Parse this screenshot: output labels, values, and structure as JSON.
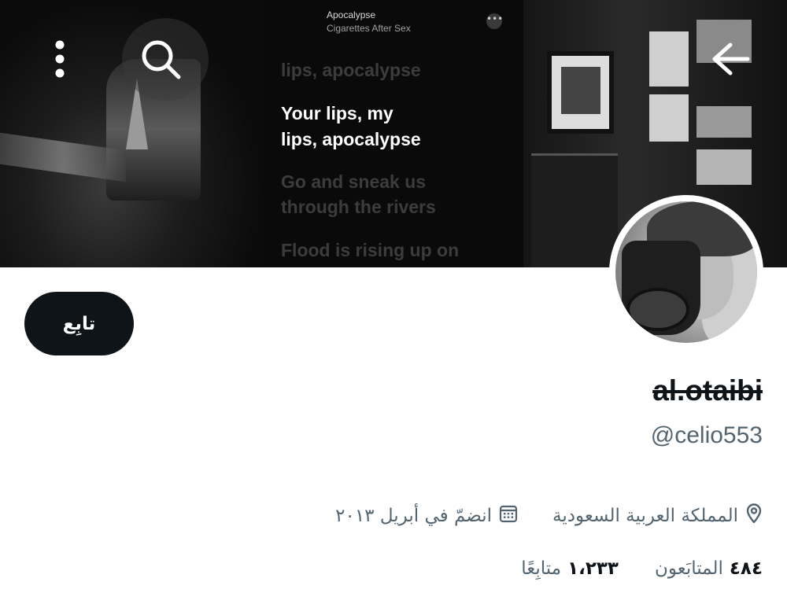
{
  "banner": {
    "song_title": "Apocalypse",
    "song_artist": "Cigarettes After Sex",
    "more_glyph": "•••",
    "lyrics": [
      {
        "text": "lips, apocalypse",
        "style": "dim"
      },
      {
        "text": "Your lips, my",
        "style": "bright"
      },
      {
        "text": "lips, apocalypse",
        "style": "bright"
      },
      {
        "text": "Go and sneak us",
        "style": "dim"
      },
      {
        "text": "through the rivers",
        "style": "dim"
      },
      {
        "text": "Flood is rising up on",
        "style": "dim"
      }
    ]
  },
  "toolbar": {
    "back_icon": "arrow-right-icon",
    "search_icon": "search-icon",
    "more_icon": "more-vertical-icon"
  },
  "profile": {
    "follow_label": "تابِع",
    "display_name": "al.otaibi",
    "handle": "@celio553",
    "location": "المملكة العربية السعودية",
    "joined": "انضمّ في أبريل ٢٠١٣",
    "followers_count": "٤٨٤",
    "followers_label": "المتابَعون",
    "following_count": "١،٢٣٣",
    "following_label": "متابِعًا"
  },
  "colors": {
    "primary_text": "#0f1419",
    "secondary_text": "#536471",
    "button_bg": "#0f1419"
  }
}
